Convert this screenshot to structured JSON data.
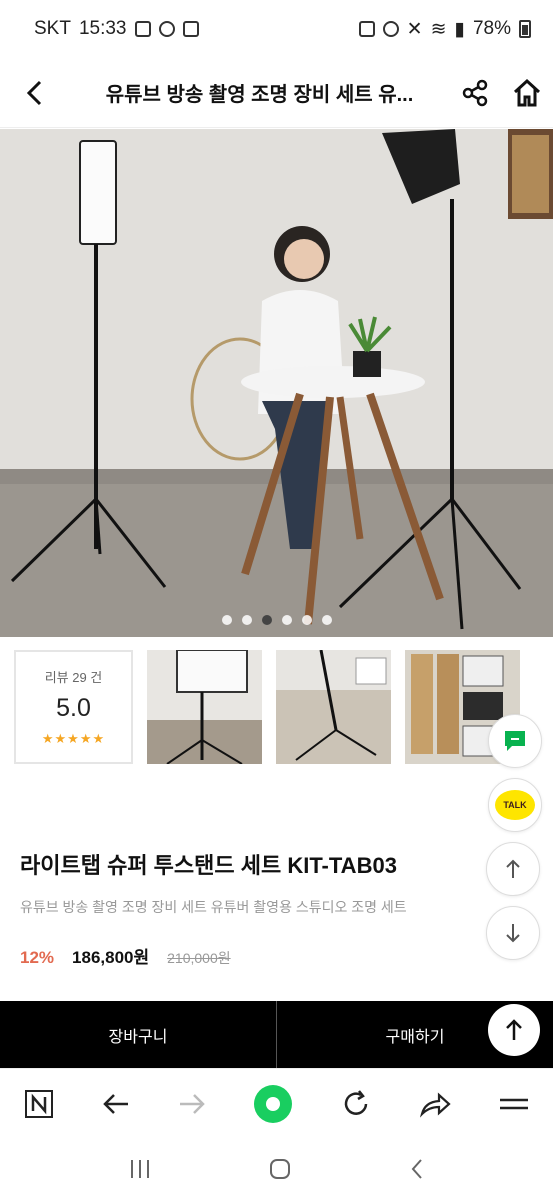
{
  "status": {
    "carrier": "SKT",
    "time": "15:33",
    "battery": "78%"
  },
  "header": {
    "title": "유튜브 방송 촬영 조명 장비 세트 유..."
  },
  "gallery": {
    "dot_count": 6,
    "active_index": 2
  },
  "review": {
    "count_label": "리뷰 29 건",
    "score": "5.0",
    "stars": "★★★★★"
  },
  "floating": {
    "talk_label": "TALK"
  },
  "product": {
    "title": "라이트탭 슈퍼 투스탠드 세트 KIT-TAB03",
    "description": "유튜브 방송 촬영 조명 장비 세트 유튜버 촬영용 스튜디오 조명 세트",
    "discount": "12%",
    "price": "186,800원",
    "original_price": "210,000원"
  },
  "actions": {
    "cart_label": "장바구니",
    "buy_label": "구매하기"
  },
  "icons": [
    "back-icon",
    "share-icon",
    "home-icon",
    "talk-icon",
    "up-arrow-icon",
    "down-arrow-icon",
    "scroll-top-icon",
    "naver-icon",
    "browser-back-icon",
    "browser-forward-icon",
    "green-dot-icon",
    "refresh-icon",
    "share-arrow-icon",
    "menu-icon"
  ],
  "colors": {
    "discount": "#e26a50",
    "stars": "#f5a623",
    "talk": "#fee500",
    "action_bar": "#000000"
  }
}
